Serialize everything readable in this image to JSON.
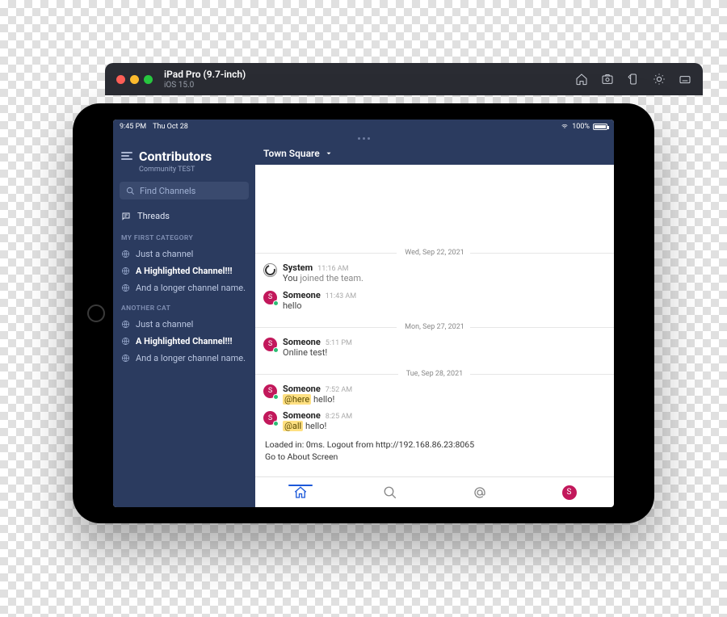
{
  "simulator": {
    "device": "iPad Pro (9.7-inch)",
    "os": "iOS 15.0"
  },
  "status_bar": {
    "time": "9:45 PM",
    "date": "Thu Oct 28",
    "battery": "100%"
  },
  "sidebar": {
    "team_name": "Contributors",
    "team_sub": "Community TEST",
    "search_placeholder": "Find Channels",
    "threads_label": "Threads",
    "categories": [
      {
        "label": "MY FIRST CATEGORY",
        "channels": [
          {
            "name": "Just a channel",
            "highlight": false
          },
          {
            "name": "A Highlighted Channel!!!",
            "highlight": true
          },
          {
            "name": "And a longer channel name.",
            "highlight": false
          }
        ]
      },
      {
        "label": "ANOTHER CAT",
        "channels": [
          {
            "name": "Just a channel",
            "highlight": false
          },
          {
            "name": "A Highlighted Channel!!!",
            "highlight": true
          },
          {
            "name": "And a longer channel name.",
            "highlight": false
          }
        ]
      }
    ]
  },
  "channel": {
    "title": "Town Square"
  },
  "messages": {
    "groups": [
      {
        "date": "Wed, Sep 22, 2021",
        "items": [
          {
            "author": "System",
            "time": "11:16 AM",
            "kind": "system",
            "text_prefix": "You ",
            "text_rest": "joined the team."
          },
          {
            "author": "Someone",
            "time": "11:43 AM",
            "kind": "user",
            "text": "hello"
          }
        ]
      },
      {
        "date": "Mon, Sep 27, 2021",
        "items": [
          {
            "author": "Someone",
            "time": "5:11 PM",
            "kind": "user",
            "text": "Online test!"
          }
        ]
      },
      {
        "date": "Tue, Sep 28, 2021",
        "items": [
          {
            "author": "Someone",
            "time": "7:52 AM",
            "kind": "user",
            "mention": "@here",
            "text_after": " hello!"
          },
          {
            "author": "Someone",
            "time": "8:25 AM",
            "kind": "user",
            "mention": "@all",
            "text_after": " hello!"
          }
        ]
      }
    ]
  },
  "footer": {
    "line1": "Loaded in: 0ms. Logout from http://192.168.86.23:8065",
    "line2": "Go to About Screen"
  },
  "avatar_letter": "S"
}
